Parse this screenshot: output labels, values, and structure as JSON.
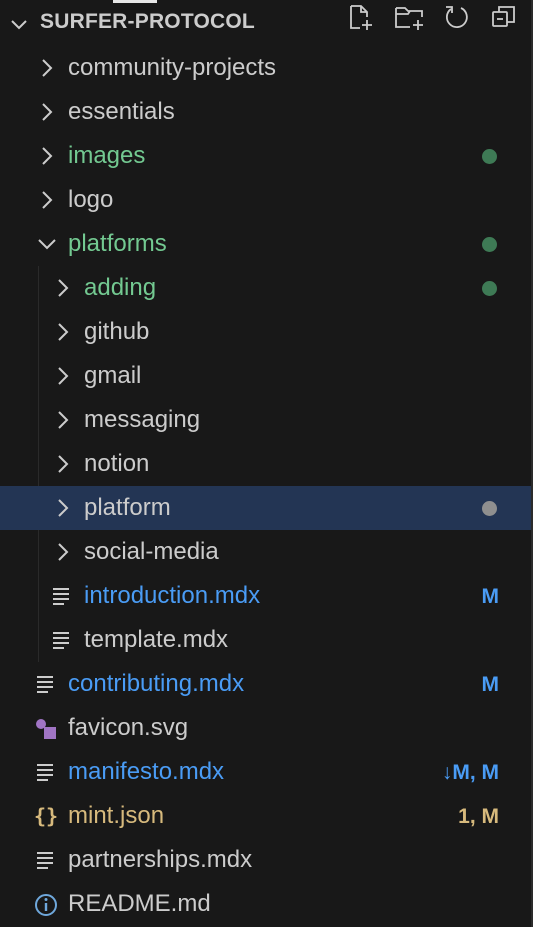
{
  "explorer": {
    "title": "SURFER-PROTOCOL",
    "actions": [
      {
        "name": "new-file-icon",
        "label": "New File"
      },
      {
        "name": "new-folder-icon",
        "label": "New Folder"
      },
      {
        "name": "refresh-icon",
        "label": "Refresh"
      },
      {
        "name": "collapse-all-icon",
        "label": "Collapse Folders"
      }
    ]
  },
  "colors": {
    "default_text": "#cccccc",
    "untracked_green": "#73c991",
    "modified_blue": "#4a9cf5",
    "json_yellow": "#d7ba7d",
    "selected_bg": "#233554",
    "dot_green": "#3e7a55",
    "dot_gray": "#8f8f8f"
  },
  "tree": [
    {
      "label": "community-projects",
      "type": "folder",
      "expanded": false,
      "depth": 0,
      "color": "default"
    },
    {
      "label": "essentials",
      "type": "folder",
      "expanded": false,
      "depth": 0,
      "color": "default"
    },
    {
      "label": "images",
      "type": "folder",
      "expanded": false,
      "depth": 0,
      "color": "green",
      "dot": "green"
    },
    {
      "label": "logo",
      "type": "folder",
      "expanded": false,
      "depth": 0,
      "color": "default"
    },
    {
      "label": "platforms",
      "type": "folder",
      "expanded": true,
      "depth": 0,
      "color": "green",
      "dot": "green"
    },
    {
      "label": "adding",
      "type": "folder",
      "expanded": false,
      "depth": 1,
      "color": "green",
      "dot": "green"
    },
    {
      "label": "github",
      "type": "folder",
      "expanded": false,
      "depth": 1,
      "color": "default"
    },
    {
      "label": "gmail",
      "type": "folder",
      "expanded": false,
      "depth": 1,
      "color": "default"
    },
    {
      "label": "messaging",
      "type": "folder",
      "expanded": false,
      "depth": 1,
      "color": "default"
    },
    {
      "label": "notion",
      "type": "folder",
      "expanded": false,
      "depth": 1,
      "color": "default"
    },
    {
      "label": "platform",
      "type": "folder",
      "expanded": false,
      "depth": 1,
      "color": "default",
      "dot": "gray",
      "selected": true
    },
    {
      "label": "social-media",
      "type": "folder",
      "expanded": false,
      "depth": 1,
      "color": "default"
    },
    {
      "label": "introduction.mdx",
      "type": "file",
      "icon": "lines",
      "depth": 1,
      "color": "blue",
      "badge": "M"
    },
    {
      "label": "template.mdx",
      "type": "file",
      "icon": "lines",
      "depth": 1,
      "color": "default"
    },
    {
      "label": "contributing.mdx",
      "type": "file",
      "icon": "lines",
      "depth": 0,
      "color": "blue",
      "badge": "M"
    },
    {
      "label": "favicon.svg",
      "type": "file",
      "icon": "svg",
      "depth": 0,
      "color": "default"
    },
    {
      "label": "manifesto.mdx",
      "type": "file",
      "icon": "lines",
      "depth": 0,
      "color": "blue",
      "badge": "↓M, M"
    },
    {
      "label": "mint.json",
      "type": "file",
      "icon": "json",
      "depth": 0,
      "color": "yellow",
      "badge": "1, M"
    },
    {
      "label": "partnerships.mdx",
      "type": "file",
      "icon": "lines",
      "depth": 0,
      "color": "default"
    },
    {
      "label": "README.md",
      "type": "file",
      "icon": "info",
      "depth": 0,
      "color": "default"
    }
  ]
}
